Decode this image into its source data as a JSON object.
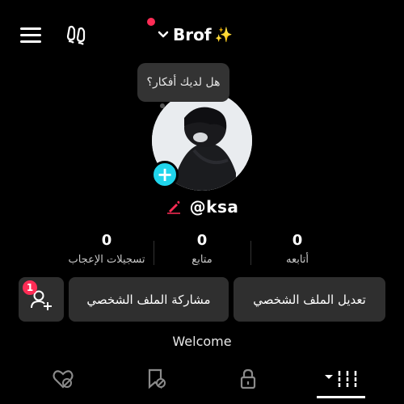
{
  "header": {
    "account_name": "Brof",
    "sparkle": "✨"
  },
  "bubble": {
    "text": "هل لديك أفكار؟"
  },
  "profile": {
    "username": "@ksa"
  },
  "stats": {
    "following": {
      "value": "0",
      "label": "أتابعه"
    },
    "followers": {
      "value": "0",
      "label": "متابع"
    },
    "likes": {
      "value": "0",
      "label": "تسجيلات الإعجاب"
    }
  },
  "actions": {
    "edit_profile": "تعديل الملف الشخصي",
    "share_profile": "مشاركة الملف الشخصي",
    "friends_badge": "1"
  },
  "bio": {
    "text": "Welcome"
  },
  "colors": {
    "accent": "#fe2c55",
    "avatar_add": "#20d5ec",
    "button_bg": "#2f2f2f"
  }
}
